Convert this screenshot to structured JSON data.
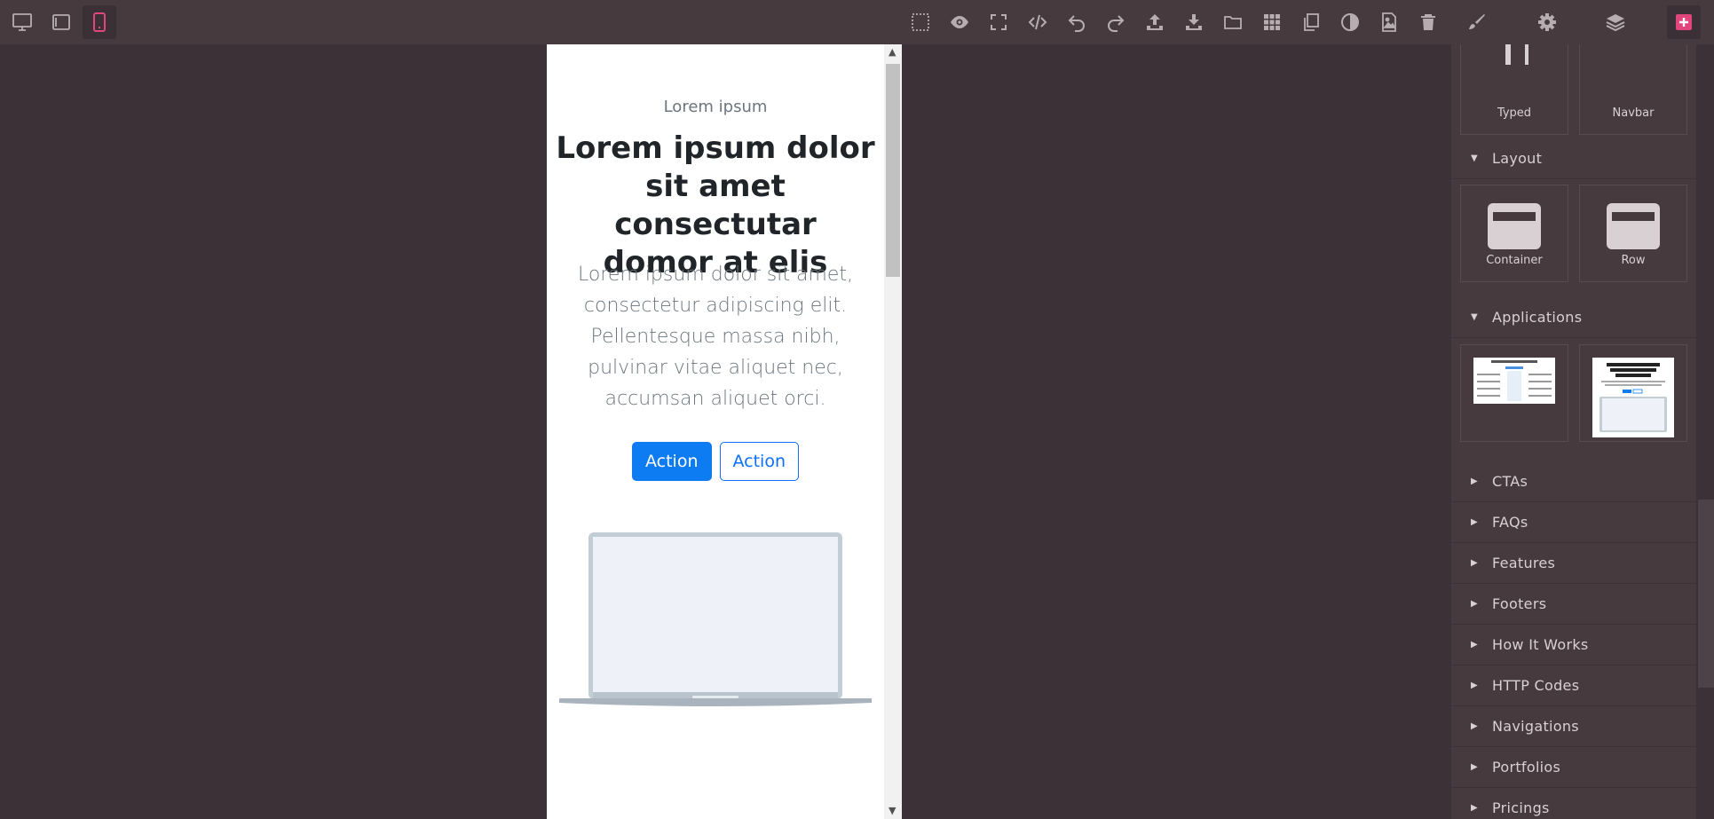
{
  "toolbar": {
    "device_buttons": [
      "desktop-icon",
      "tablet-icon",
      "mobile-icon"
    ],
    "action_icons": [
      "select-outline-icon",
      "eye-icon",
      "fullscreen-icon",
      "code-icon",
      "undo-icon",
      "redo-icon",
      "upload-icon",
      "download-icon",
      "folder-icon",
      "grid-icon",
      "copy-icon",
      "contrast-icon",
      "image-icon",
      "trash-icon"
    ],
    "panel_icons": [
      "brush-icon",
      "gear-icon",
      "layers-icon",
      "plus-square-icon"
    ],
    "accent_color": "#e0457b"
  },
  "canvas": {
    "eyebrow": "Lorem ipsum",
    "headline": "Lorem ipsum dolor sit amet consectutar domor at elis",
    "lead": "Lorem ipsum dolor sit amet, consectetur adipiscing elit. Pellentesque massa nibh, pulvinar vitae aliquet nec, accumsan aliquet orci.",
    "primary_button": "Action",
    "secondary_button": "Action",
    "primary_color": "#0d7bf2"
  },
  "blocks": {
    "top": [
      {
        "label": "Typed"
      },
      {
        "label": "Navbar"
      }
    ],
    "layout_title": "Layout",
    "layout": [
      {
        "label": "Container"
      },
      {
        "label": "Row"
      }
    ],
    "applications_title": "Applications",
    "categories": [
      "CTAs",
      "FAQs",
      "Features",
      "Footers",
      "How It Works",
      "HTTP Codes",
      "Navigations",
      "Portfolios",
      "Pricings"
    ]
  }
}
